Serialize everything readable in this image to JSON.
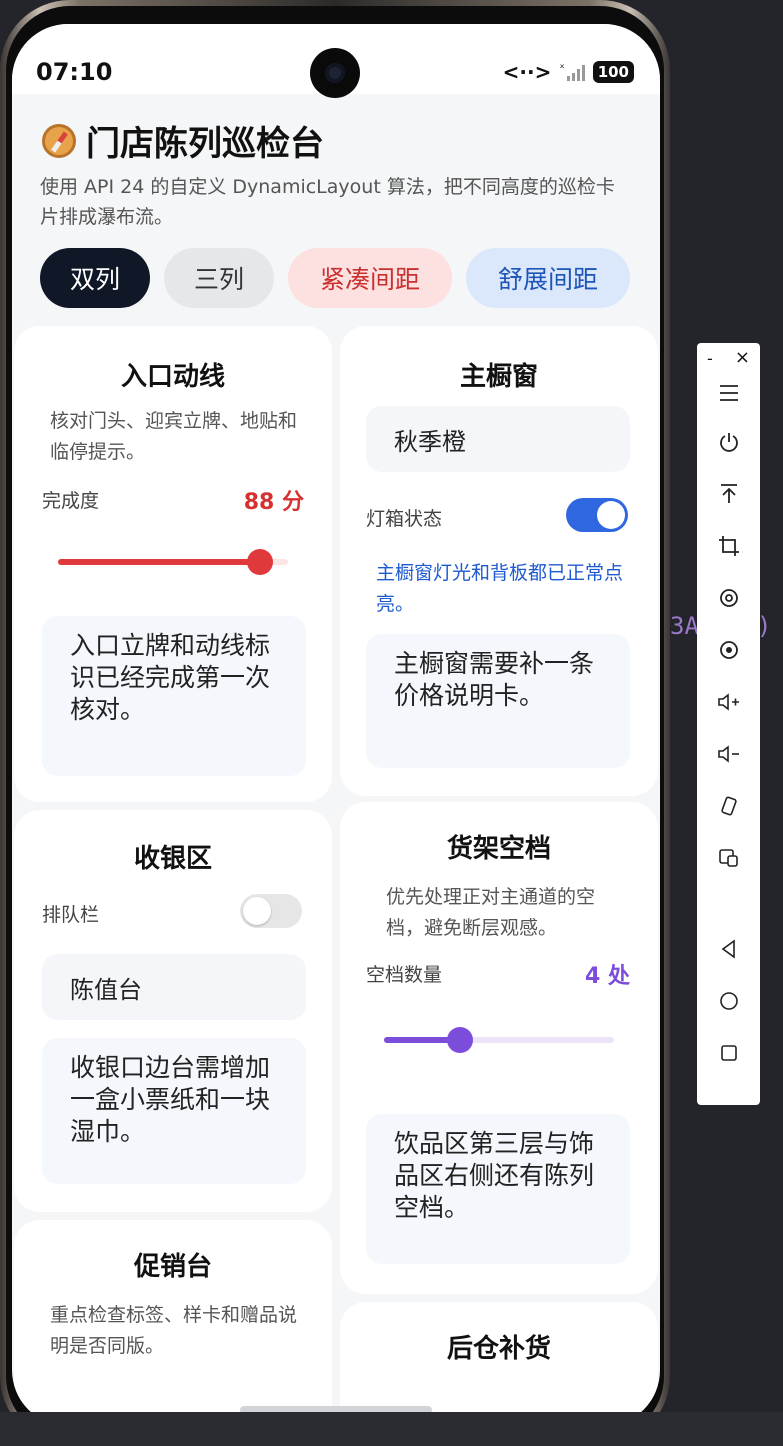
{
  "status_bar": {
    "time": "07:10",
    "nfc": "<··>",
    "signal": "ˣ",
    "battery": "100"
  },
  "header": {
    "title": "门店陈列巡检台",
    "description": "使用 API 24 的自定义 DynamicLayout 算法，把不同高度的巡检卡片排成瀑布流。"
  },
  "chips": [
    {
      "label": "双列",
      "color": "#101828"
    },
    {
      "label": "三列",
      "color": "#e5e7eb"
    },
    {
      "label": "紧凑间距",
      "color": "#fde0e0"
    },
    {
      "label": "舒展间距",
      "color": "#dbe8fb"
    }
  ],
  "cards": {
    "entrance": {
      "title": "入口动线",
      "description": "核对门头、迎宾立牌、地贴和临停提示。",
      "metric_label": "完成度",
      "metric_value": "88 分",
      "slider_fraction": 0.88,
      "slider_color": "#e0393b",
      "note": "入口立牌和动线标识已经完成第一次核对。"
    },
    "main_window": {
      "title": "主橱窗",
      "theme_value": "秋季橙",
      "toggle_label": "灯箱状态",
      "toggle_on": true,
      "status_text": "主橱窗灯光和背板都已正常点亮。",
      "note": "主橱窗需要补一条价格说明卡。"
    },
    "checkout": {
      "title": "收银区",
      "toggle_label": "排队栏",
      "toggle_on": false,
      "field_value": "陈值台",
      "note": "收银口边台需增加一盒小票纸和一块湿巾。"
    },
    "shelf_gap": {
      "title": "货架空档",
      "description": "优先处理正对主通道的空档，避免断层观感。",
      "metric_label": "空档数量",
      "metric_value": "4 处",
      "slider_fraction": 0.33,
      "slider_color": "#7c4ddb",
      "note": "饮品区第三层与饰品区右侧还有陈列空档。"
    },
    "promo": {
      "title": "促销台",
      "description": "重点检查标签、样卡和赠品说明是否同版。"
    },
    "restock": {
      "title": "后仓补货"
    }
  },
  "side_toolbar": {
    "minimize": "-",
    "close": "×",
    "items": [
      "menu-icon",
      "power-icon",
      "pin-top-icon",
      "crop-icon",
      "rotate-icon",
      "screenshot-icon",
      "volume-up-icon",
      "volume-down-icon",
      "shake-icon",
      "multi-window-icon",
      "back-icon",
      "home-icon",
      "recents-icon"
    ]
  },
  "side_code": {
    "left": "3A",
    "right": ")"
  }
}
